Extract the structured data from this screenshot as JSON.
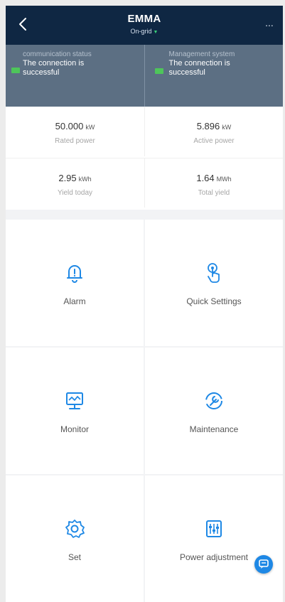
{
  "header": {
    "title": "EMMA",
    "subtitle": "On-grid",
    "more_label": "..."
  },
  "status": {
    "communication": {
      "label": "communication status",
      "value": "The connection is successful"
    },
    "management": {
      "label": "Management system",
      "value": "The connection is successful"
    }
  },
  "kpis": [
    {
      "value": "50.000",
      "unit": "kW",
      "label": "Rated power"
    },
    {
      "value": "5.896",
      "unit": "kW",
      "label": "Active power"
    },
    {
      "value": "2.95",
      "unit": "kWh",
      "label": "Yield today"
    },
    {
      "value": "1.64",
      "unit": "MWh",
      "label": "Total yield"
    }
  ],
  "tiles": [
    {
      "label": "Alarm",
      "icon": "bell-icon"
    },
    {
      "label": "Quick Settings",
      "icon": "touch-icon"
    },
    {
      "label": "Monitor",
      "icon": "monitor-icon"
    },
    {
      "label": "Maintenance",
      "icon": "wrench-icon"
    },
    {
      "label": "Set",
      "icon": "gear-icon"
    },
    {
      "label": "Power adjustment",
      "icon": "sliders-icon"
    }
  ],
  "colors": {
    "header_bg": "#0f2743",
    "status_bg": "#5c6f83",
    "accent_blue": "#1e88e5",
    "ok_green": "#4ec55a"
  }
}
